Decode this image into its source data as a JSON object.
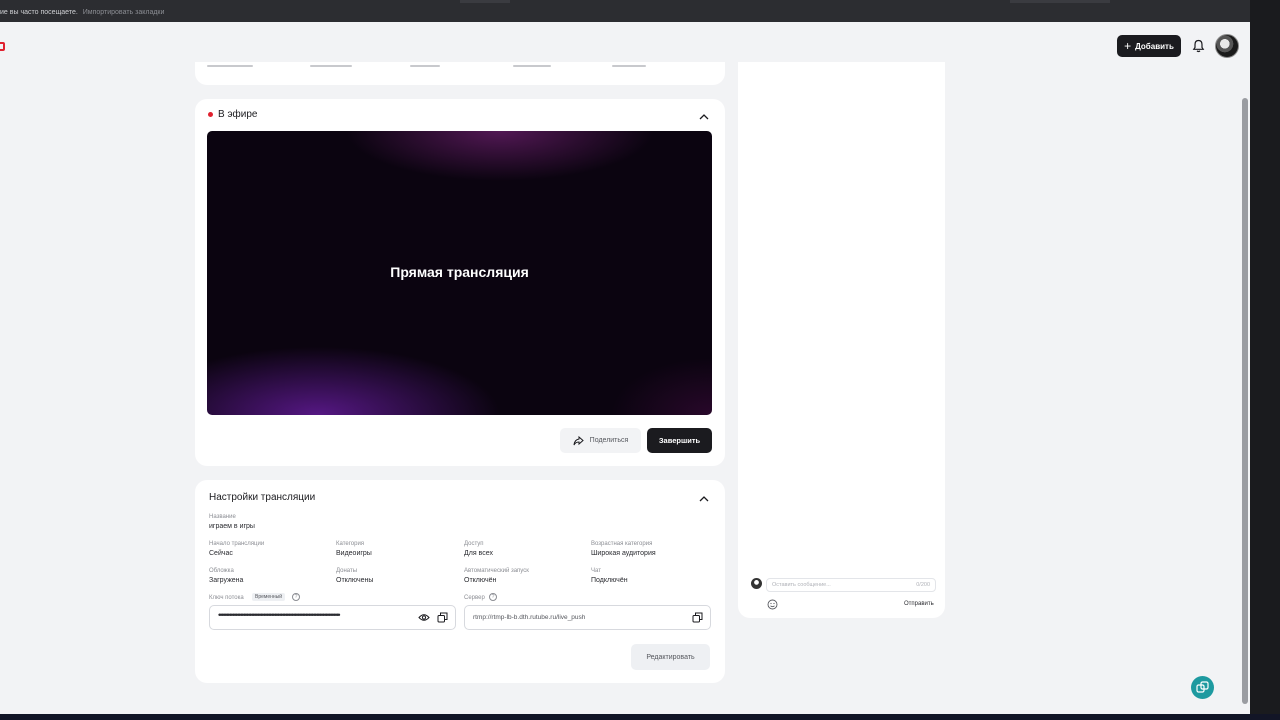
{
  "browser": {
    "bookmarks_label": "ие вы часто посещаете.",
    "import_link": "Импортировать закладки"
  },
  "header": {
    "add_button": "Добавить",
    "bell_icon": "bell-icon",
    "avatar_icon": "user-avatar"
  },
  "live": {
    "title": "В эфире",
    "player_label": "Прямая трансляция",
    "share_button": "Поделиться",
    "end_button": "Завершить",
    "accent": "#e0212f"
  },
  "settings": {
    "title": "Настройки трансляции",
    "name": {
      "label": "Название",
      "value": "играем в игры"
    },
    "start": {
      "label": "Начало трансляции",
      "value": "Сейчас"
    },
    "category": {
      "label": "Категория",
      "value": "Видеоигры"
    },
    "access": {
      "label": "Доступ",
      "value": "Для всех"
    },
    "age": {
      "label": "Возрастная категория",
      "value": "Широкая аудитория"
    },
    "cover": {
      "label": "Обложка",
      "value": "Загружена"
    },
    "donations": {
      "label": "Донаты",
      "value": "Отключены"
    },
    "autostart": {
      "label": "Автоматический запуск",
      "value": "Отключён"
    },
    "chat": {
      "label": "Чат",
      "value": "Подключён"
    },
    "stream_key": {
      "label": "Ключ потока",
      "badge": "Временный",
      "value": "••••••••••••••••••••••••••••••••••••••••••••••••••••••••••••••••••••••••••••••"
    },
    "server": {
      "label": "Сервер",
      "value": "rtmp://rtmp-lb-b.dth.rutube.ru/live_push"
    },
    "edit_button": "Редактировать"
  },
  "chat": {
    "placeholder": "Оставить сообщение...",
    "counter": "0/200",
    "send": "Отправить"
  },
  "colors": {
    "page_bg": "#f2f3f5",
    "dark_button": "#1b1b1f",
    "support_button": "#1e9aa0"
  }
}
